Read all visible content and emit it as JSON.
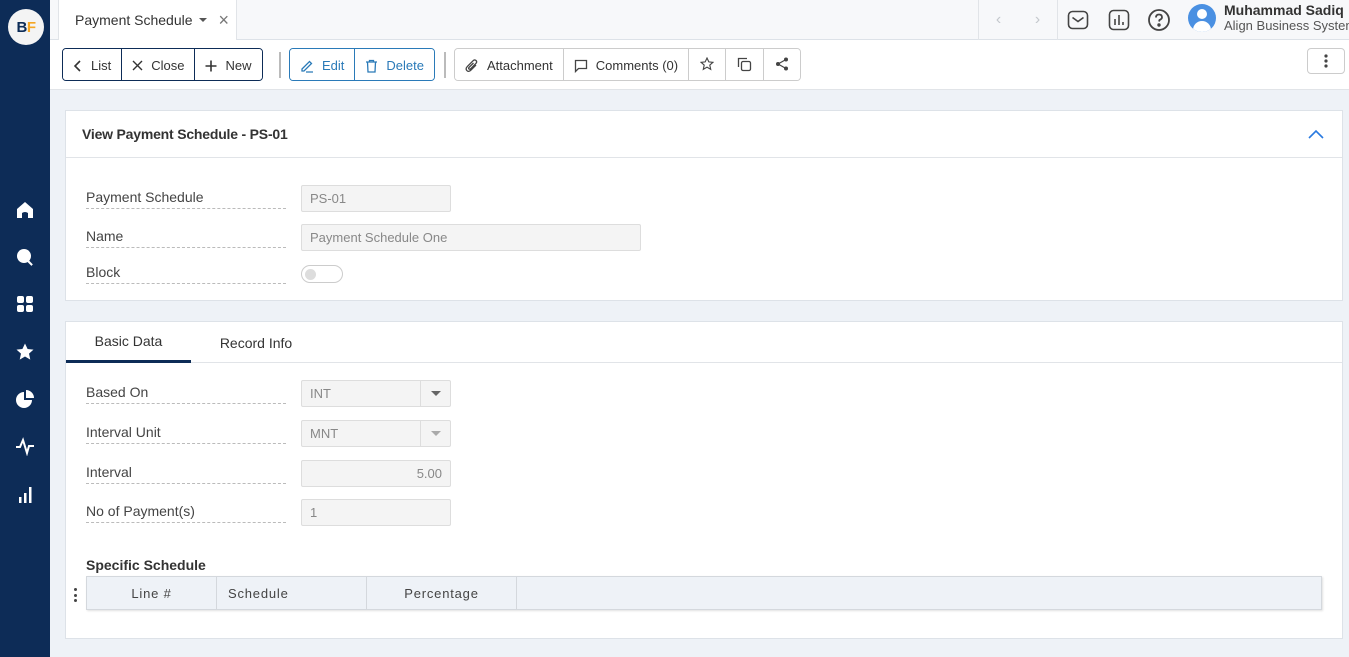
{
  "app": {
    "logo_b": "B",
    "logo_f": "F"
  },
  "sidebar": {
    "items": [
      {
        "name": "home",
        "icon": "home-icon"
      },
      {
        "name": "search",
        "icon": "search-icon"
      },
      {
        "name": "apps",
        "icon": "grid-icon"
      },
      {
        "name": "favorites",
        "icon": "star-icon"
      },
      {
        "name": "reports",
        "icon": "pie-chart-icon"
      },
      {
        "name": "activity",
        "icon": "activity-icon"
      },
      {
        "name": "analytics",
        "icon": "bar-chart-icon"
      }
    ]
  },
  "topbar": {
    "tab_label": "Payment Schedule",
    "tab_close": "×",
    "prev": "‹",
    "next": "›",
    "user_name": "Muhammad Sadiq",
    "user_org": "Align Business Systems"
  },
  "toolbar": {
    "list": "List",
    "close": "Close",
    "new": "New",
    "edit": "Edit",
    "delete": "Delete",
    "attachment": "Attachment",
    "comments": "Comments (0)"
  },
  "header_card": {
    "title": "View Payment Schedule - PS-01",
    "fields": {
      "payment_schedule_label": "Payment Schedule",
      "payment_schedule_value": "PS-01",
      "name_label": "Name",
      "name_value": "Payment Schedule One",
      "block_label": "Block",
      "block_on": false
    }
  },
  "detail_card": {
    "tabs": [
      {
        "label": "Basic Data",
        "active": true
      },
      {
        "label": "Record Info",
        "active": false
      }
    ],
    "fields": {
      "based_on_label": "Based On",
      "based_on_value": "INT",
      "interval_unit_label": "Interval Unit",
      "interval_unit_value": "MNT",
      "interval_label": "Interval",
      "interval_value": "5.00",
      "no_payments_label": "No of Payment(s)",
      "no_payments_value": "1"
    },
    "specific_schedule": {
      "title": "Specific Schedule",
      "columns": [
        "Line #",
        "Schedule",
        "Percentage"
      ],
      "rows": []
    }
  }
}
